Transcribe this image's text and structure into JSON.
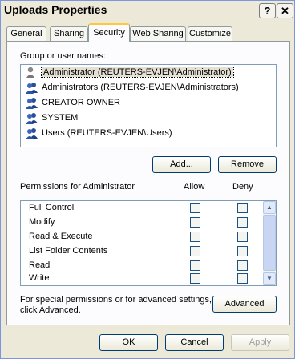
{
  "window": {
    "title": "Uploads Properties",
    "help_glyph": "?",
    "close_glyph": "✕"
  },
  "tabs": [
    {
      "label": "General"
    },
    {
      "label": "Sharing"
    },
    {
      "label": "Security",
      "active": true
    },
    {
      "label": "Web Sharing"
    },
    {
      "label": "Customize"
    }
  ],
  "security": {
    "group_label": "Group or user names:",
    "users": [
      {
        "name": "Administrator (REUTERS-EVJEN\\Administrator)",
        "selected": true
      },
      {
        "name": "Administrators (REUTERS-EVJEN\\Administrators)"
      },
      {
        "name": "CREATOR OWNER"
      },
      {
        "name": "SYSTEM"
      },
      {
        "name": "Users (REUTERS-EVJEN\\Users)"
      }
    ],
    "add_label": "Add...",
    "remove_label": "Remove",
    "permissions_label": "Permissions for Administrator",
    "allow_label": "Allow",
    "deny_label": "Deny",
    "permissions": [
      {
        "name": "Full Control"
      },
      {
        "name": "Modify"
      },
      {
        "name": "Read & Execute"
      },
      {
        "name": "List Folder Contents"
      },
      {
        "name": "Read"
      },
      {
        "name": "Write"
      }
    ],
    "advanced_text_1": "For special permissions or for advanced settings,",
    "advanced_text_2": "click Advanced.",
    "advanced_label": "Advanced"
  },
  "footer": {
    "ok_label": "OK",
    "cancel_label": "Cancel",
    "apply_label": "Apply"
  }
}
